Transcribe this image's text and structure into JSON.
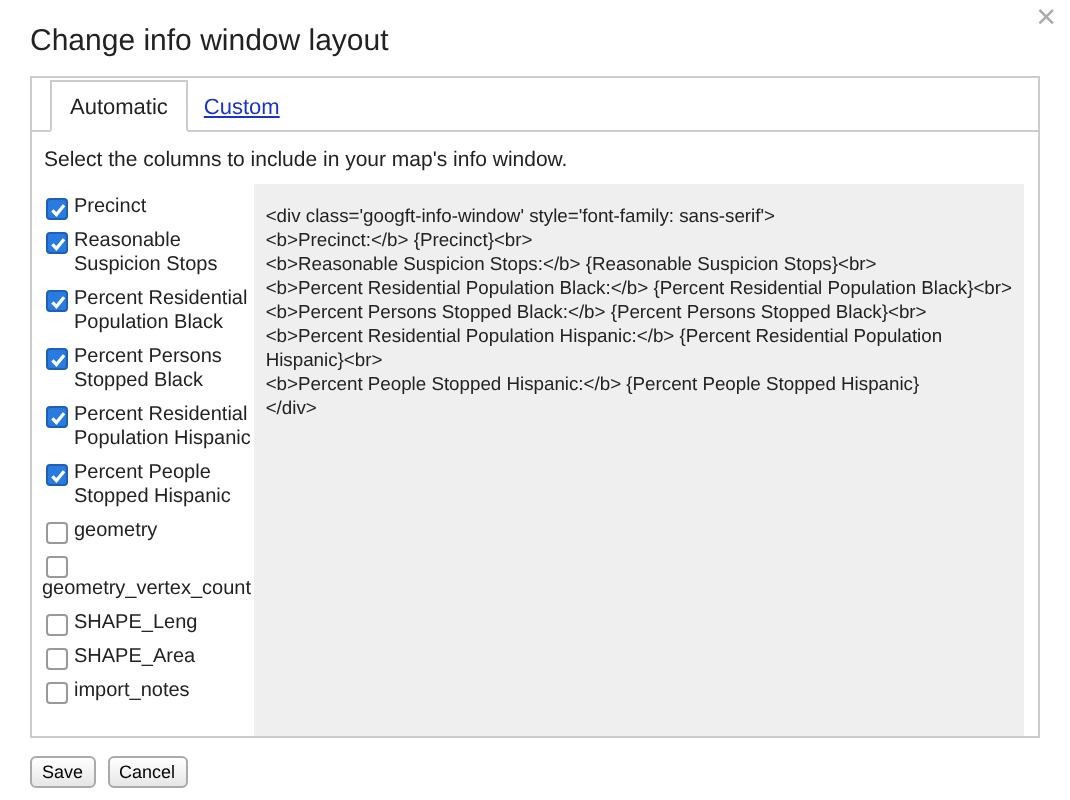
{
  "dialog": {
    "title": "Change info window layout",
    "close": "×"
  },
  "tabs": [
    {
      "label": "Automatic",
      "selected": true
    },
    {
      "label": "Custom",
      "selected": false
    }
  ],
  "instructions": "Select the columns to include in your map's info window.",
  "columns": [
    {
      "label": "Precinct",
      "checked": true
    },
    {
      "label": "Reasonable Suspicion Stops",
      "checked": true
    },
    {
      "label": "Percent Residential Population Black",
      "checked": true
    },
    {
      "label": "Percent Persons Stopped Black",
      "checked": true
    },
    {
      "label": "Percent Residential Population Hispanic",
      "checked": true
    },
    {
      "label": "Percent People Stopped Hispanic",
      "checked": true
    },
    {
      "label": "geometry",
      "checked": false
    },
    {
      "label": "geometry_vertex_count",
      "checked": false
    },
    {
      "label": "SHAPE_Leng",
      "checked": false
    },
    {
      "label": "SHAPE_Area",
      "checked": false
    },
    {
      "label": "import_notes",
      "checked": false
    }
  ],
  "template_lines": [
    "<div class='googft-info-window' style='font-family: sans-serif'>",
    "<b>Precinct:</b> {Precinct}<br>",
    "<b>Reasonable Suspicion Stops:</b> {Reasonable Suspicion Stops}<br>",
    "<b>Percent Residential Population Black:</b> {Percent Residential Population Black}<br>",
    "<b>Percent Persons Stopped Black:</b> {Percent Persons Stopped Black}<br>",
    "<b>Percent Residential Population Hispanic:</b> {Percent Residential Population",
    "Hispanic}<br>",
    "<b>Percent People Stopped Hispanic:</b> {Percent People Stopped Hispanic}",
    "</div>"
  ],
  "buttons": [
    "Save",
    "Cancel"
  ]
}
